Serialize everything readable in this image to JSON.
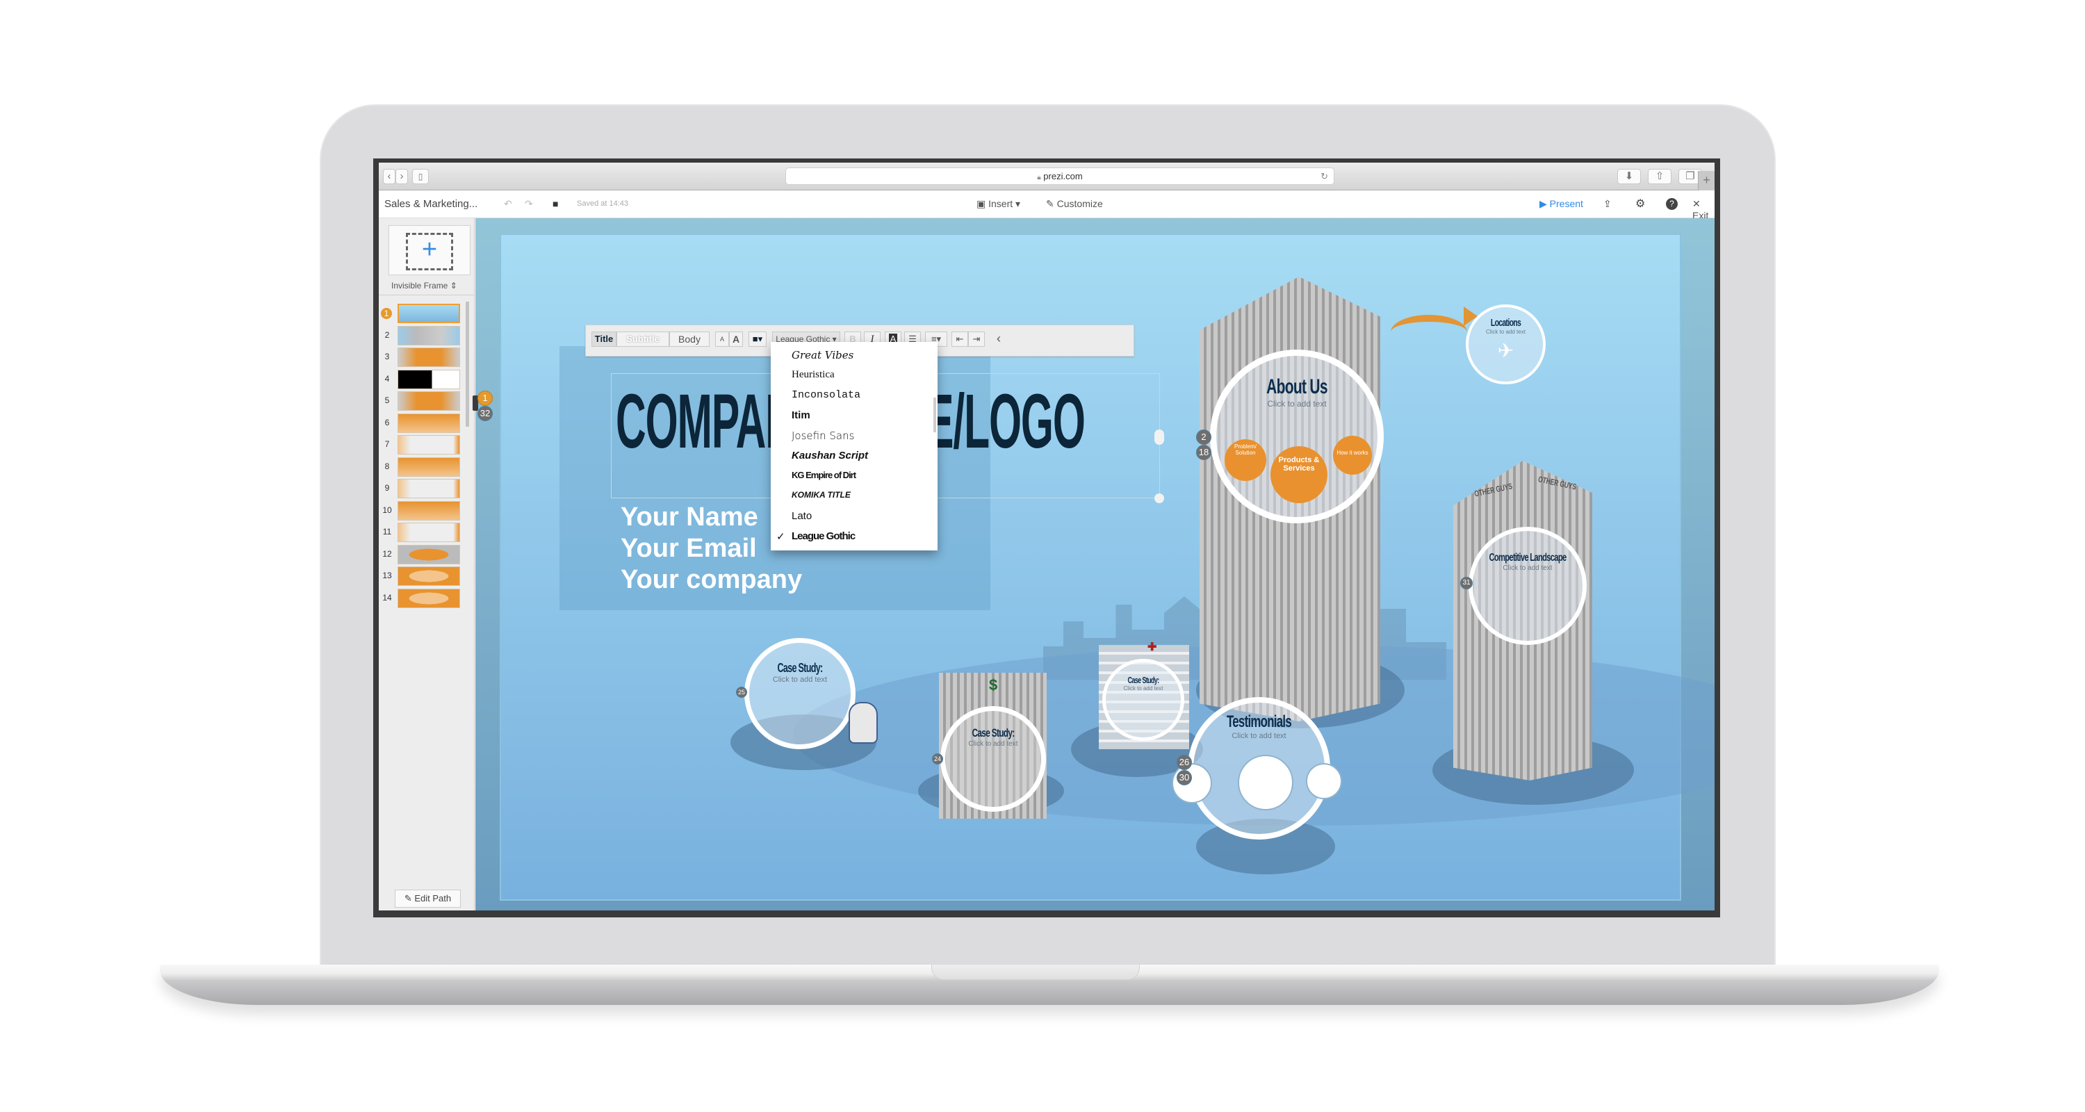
{
  "browser": {
    "url": "prezi.com",
    "back_icon": "‹",
    "forward_icon": "›",
    "sidebar_icon": "▯",
    "reload_icon": "↻",
    "download_icon": "⬇",
    "share_icon": "⇧",
    "tabs_icon": "❐",
    "new_tab_icon": "+"
  },
  "appbar": {
    "title": "Sales & Marketing...",
    "undo_icon": "↶",
    "redo_icon": "↷",
    "save_icon": "■",
    "saved_status": "Saved at 14:43",
    "insert_label": "Insert ▾",
    "customize_label": "Customize",
    "present_label": "Present",
    "present_icon": "▶",
    "share_icon": "⇪",
    "settings_icon": "⚙",
    "help_icon": "?",
    "exit_icon": "✕",
    "exit_label": "Exit"
  },
  "sidebar": {
    "add_frame_icon": "+",
    "frame_type": "Invisible Frame ⇕",
    "current_step": "1",
    "thumbnails": [
      "1",
      "2",
      "3",
      "4",
      "5",
      "6",
      "7",
      "8",
      "9",
      "10",
      "11",
      "12",
      "13",
      "14"
    ],
    "edit_path_label": "✎ Edit Path"
  },
  "canvas": {
    "path_step_current": "1",
    "path_step_total": "32",
    "title_text": "COMPANY NAME/LOGO",
    "info_lines": [
      "Your Name",
      "Your Email",
      "Your company"
    ],
    "text_toolbar": {
      "styles": [
        "Title",
        "Subtitle",
        "Body"
      ],
      "size_small": "A",
      "size_large": "A",
      "color_icon": "■▾",
      "font_selected": "League Gothic ▾",
      "bold": "B",
      "italic": "I",
      "highlight": "A",
      "bullets_icon": "☰",
      "align_icon": "≡▾",
      "outdent_icon": "⇤",
      "indent_icon": "⇥",
      "collapse_icon": "‹"
    },
    "font_menu": {
      "options": [
        "Great Vibes",
        "Heuristica",
        "Inconsolata",
        "Itim",
        "Josefin Sans",
        "Kaushan Script",
        "KG Empire of Dirt",
        "KOMIKA TITLE",
        "Lato",
        "League Gothic"
      ],
      "selected": "League Gothic",
      "check_icon": "✓"
    },
    "frames": [
      {
        "title": "About Us",
        "subtitle": "Click to add text",
        "step": "2",
        "step2": "18"
      },
      {
        "title": "Locations",
        "subtitle": "Click to add text"
      },
      {
        "title": "Competitive Landscape",
        "subtitle": "Click to add text",
        "step": "31"
      },
      {
        "title": "Case Study:",
        "subtitle": "Click to add text",
        "step": "25"
      },
      {
        "title": "Case Study:",
        "subtitle": "Click to add text",
        "step": "24"
      },
      {
        "title": "Case Study:",
        "subtitle": "Click to add text"
      },
      {
        "title": "Testimonials",
        "subtitle": "Click to add text",
        "step": "26",
        "step2": "30"
      }
    ],
    "sub_frames": [
      "Problem/ Solution",
      "Products & Services",
      "How it works"
    ],
    "building_labels": [
      "OTHER GUYS",
      "OTHER GUYS"
    ],
    "zoom_controls": {
      "home_icon": "⌂",
      "zoom_in_icon": "⊕",
      "zoom_out_icon": "⊖"
    }
  }
}
